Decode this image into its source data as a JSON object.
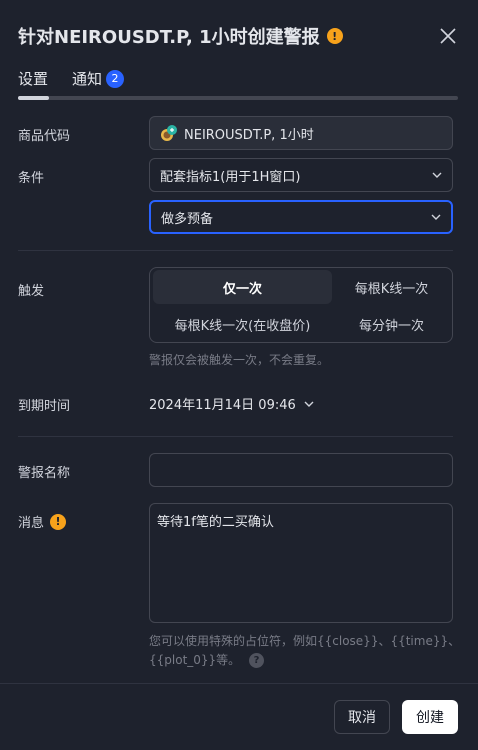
{
  "header": {
    "title": "针对NEIROUSDT.P, 1小时创建警报",
    "warn_glyph": "!"
  },
  "tabs": [
    {
      "label": "设置"
    },
    {
      "label": "通知",
      "badge": "2"
    }
  ],
  "form": {
    "symbol": {
      "label": "商品代码",
      "value": "NEIROUSDT.P, 1小时"
    },
    "condition": {
      "label": "条件",
      "value": "配套指标1(用于1H窗口)",
      "sub_value": "做多预备"
    },
    "trigger": {
      "label": "触发",
      "options": [
        "仅一次",
        "每根K线一次",
        "每根K线一次(在收盘价)",
        "每分钟一次"
      ],
      "selected": "仅一次",
      "hint": "警报仅会被触发一次，不会重复。"
    },
    "expiry": {
      "label": "到期时间",
      "value": "2024年11月14日 09:46"
    },
    "alert_name": {
      "label": "警报名称",
      "value": ""
    },
    "message": {
      "label": "消息",
      "warn_glyph": "!",
      "value": "等待1f笔的二买确认",
      "hint_line1": "您可以使用特殊的占位符，例如{{close}}、{{time}}、",
      "hint_line2": "{{plot_0}}等。",
      "help_glyph": "?"
    }
  },
  "footer": {
    "cancel_label": "取消",
    "create_label": "创建"
  },
  "colors": {
    "background": "#1e222d",
    "accent": "#2962ff",
    "warning": "#f7a21b",
    "border": "#434651"
  }
}
